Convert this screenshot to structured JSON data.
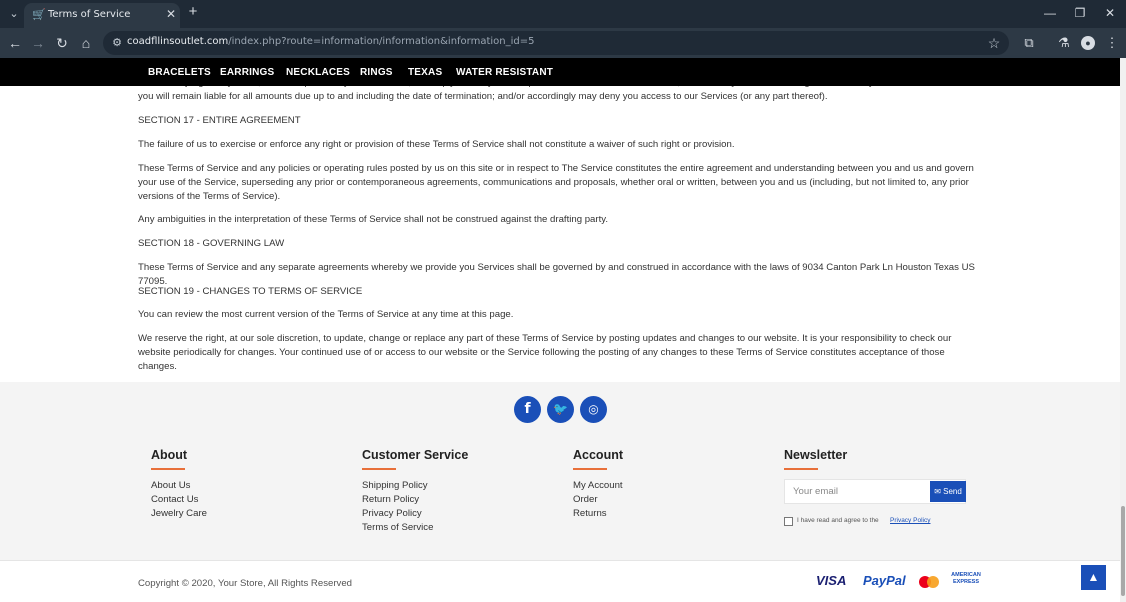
{
  "browser": {
    "tab_title": "Terms of Service",
    "url_domain": "coadfllinsoutlet.com",
    "url_path": "/index.php?route=information/information&information_id=5"
  },
  "site_nav": [
    "BRACELETS",
    "EARRINGS",
    "NECKLACES",
    "RINGS",
    "TEXAS",
    "WATER RESISTANT"
  ],
  "terms": {
    "partial_top": "In our sole judgment you fail, or we suspect that you have failed, to comply with any term or provision of these Terms of Service, we also may terminate this agreement at any time without notice and you will remain liable for all amounts due up to and including the date of termination; and/or accordingly may deny you access to our Services (or any part thereof).",
    "s17_heading": "SECTION 17 - ENTIRE AGREEMENT",
    "s17_p1": "The failure of us to exercise or enforce any right or provision of these Terms of Service shall not constitute a waiver of such right or provision.",
    "s17_p2": "These Terms of Service and any policies or operating rules posted by us on this site or in respect to The Service constitutes the entire agreement and understanding between you and us and govern your use of the Service, superseding any prior or contemporaneous agreements, communications and proposals, whether oral or written, between you and us (including, but not limited to, any prior versions of the Terms of Service).",
    "s17_p3": "Any ambiguities in the interpretation of these Terms of Service shall not be construed against the drafting party.",
    "s18_heading": "SECTION 18 - GOVERNING LAW",
    "s18_p1": "These Terms of Service and any separate agreements whereby we provide you Services shall be governed by and construed in accordance with the laws of 9034 Canton Park Ln Houston Texas US 77095.",
    "s19_heading": "SECTION 19 - CHANGES TO TERMS OF SERVICE",
    "s19_p1": "You can review the most current version of the Terms of Service at any time at this page.",
    "s19_p2": "We reserve the right, at our sole discretion, to update, change or replace any part of these Terms of Service by posting updates and changes to our website. It is your responsibility to check our website periodically for changes. Your continued use of or access to our website or the Service following the posting of any changes to these Terms of Service constitutes acceptance of those changes."
  },
  "footer": {
    "about": {
      "title": "About",
      "links": [
        "About Us",
        "Contact Us",
        "Jewelry Care"
      ]
    },
    "customer_service": {
      "title": "Customer Service",
      "links": [
        "Shipping Policy",
        "Return Policy",
        "Privacy Policy",
        "Terms of Service"
      ]
    },
    "account": {
      "title": "Account",
      "links": [
        "My Account",
        "Order",
        "Returns"
      ]
    },
    "newsletter": {
      "title": "Newsletter",
      "placeholder": "Your email",
      "send_label": "Send",
      "agree_text": "I have read and agree to the",
      "agree_link": "Privacy Policy"
    },
    "copyright": "Copyright © 2020, Your Store, All Rights Reserved",
    "payments": [
      "VISA",
      "PayPal",
      "AMERICAN EXPRESS"
    ]
  },
  "colors": {
    "accent": "#1a4fb8",
    "underline": "#e8703a",
    "nav_bg": "#000000"
  }
}
